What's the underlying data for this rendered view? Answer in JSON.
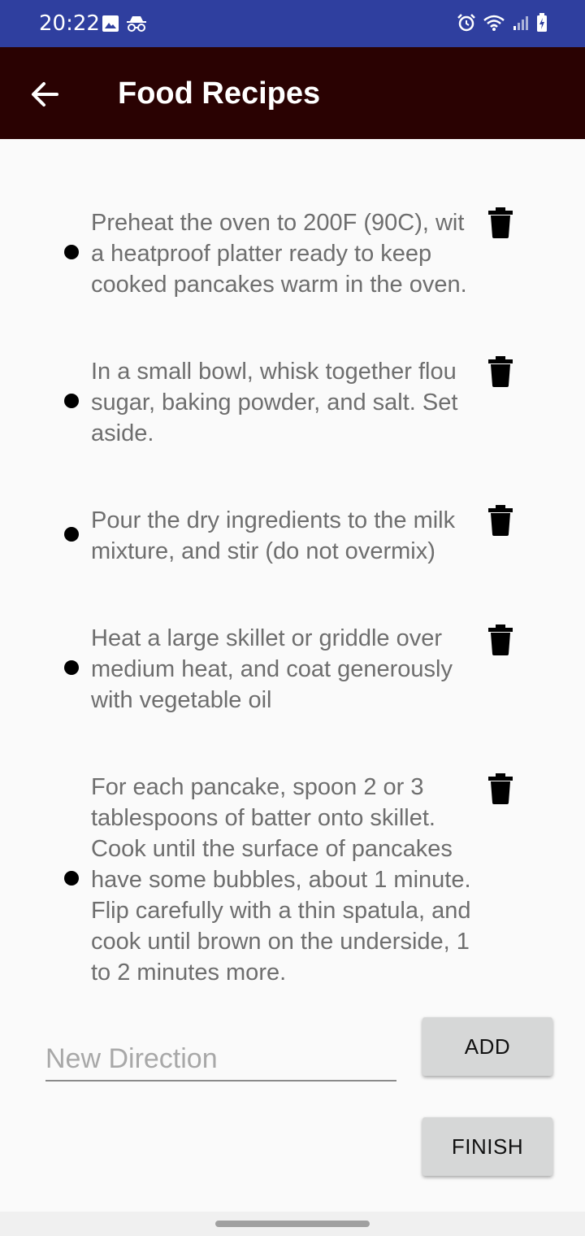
{
  "status_bar": {
    "time": "20:22",
    "left_icons": [
      "image-icon",
      "incognito-icon"
    ],
    "right_icons": [
      "alarm-icon",
      "wifi-icon",
      "signal-icon",
      "battery-charging-icon"
    ]
  },
  "app_bar": {
    "title": "Food Recipes",
    "back_icon": "arrow-back-icon"
  },
  "directions": [
    {
      "text": "Preheat the oven to 200F (90C), wit\na heatproof platter ready to keep\ncooked pancakes warm in the oven."
    },
    {
      "text": "In a small bowl, whisk together flou\nsugar, baking powder, and salt. Set\naside."
    },
    {
      "text": "Pour the dry ingredients to the milk\nmixture, and stir (do not overmix)"
    },
    {
      "text": "Heat a large skillet or griddle over\nmedium heat, and coat generously\nwith vegetable oil"
    },
    {
      "text": "For each pancake, spoon 2 or 3\ntablespoons of batter onto skillet.\nCook until the surface of pancakes\nhave some bubbles, about 1 minute.\nFlip carefully with a thin spatula, and\ncook until brown on the underside, 1\nto 2 minutes more."
    }
  ],
  "new_direction": {
    "placeholder": "New Direction",
    "value": ""
  },
  "buttons": {
    "add_label": "ADD",
    "finish_label": "FINISH"
  },
  "colors": {
    "status_bar": "#2f3f9f",
    "app_bar": "#2a0202",
    "background": "#fafafa",
    "button": "#d6d7d7"
  }
}
